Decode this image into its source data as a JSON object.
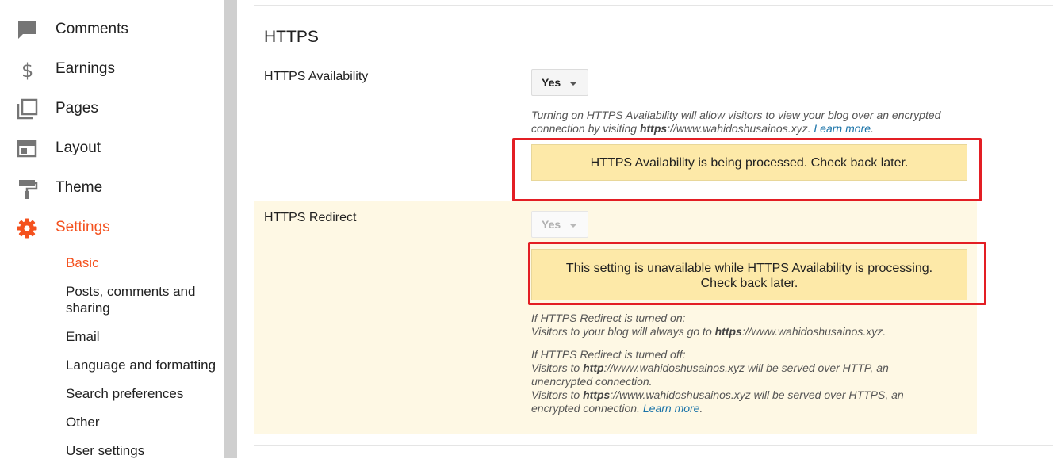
{
  "sidebar": {
    "items": [
      {
        "label": "Comments",
        "icon": "comment-icon"
      },
      {
        "label": "Earnings",
        "icon": "dollar-icon"
      },
      {
        "label": "Pages",
        "icon": "pages-icon"
      },
      {
        "label": "Layout",
        "icon": "layout-icon"
      },
      {
        "label": "Theme",
        "icon": "paint-roller-icon"
      },
      {
        "label": "Settings",
        "icon": "gear-icon",
        "active": true
      }
    ],
    "sub_items": [
      {
        "label": "Basic",
        "active": true
      },
      {
        "label": "Posts, comments and sharing"
      },
      {
        "label": "Email"
      },
      {
        "label": "Language and formatting"
      },
      {
        "label": "Search preferences"
      },
      {
        "label": "Other"
      },
      {
        "label": "User settings"
      }
    ],
    "accent_color": "#f4511e"
  },
  "main": {
    "section_title": "HTTPS",
    "availability": {
      "label": "HTTPS Availability",
      "value": "Yes",
      "help_prefix": "Turning on HTTPS Availability will allow visitors to view your blog over an encrypted connection by visiting ",
      "help_bold": "https",
      "help_suffix": "://www.wahidoshusainos.xyz. ",
      "help_link": "Learn more",
      "help_end": ".",
      "notice": "HTTPS Availability is being processed. Check back later."
    },
    "redirect": {
      "label": "HTTPS Redirect",
      "value": "Yes",
      "notice_line1": "This setting is unavailable while HTTPS Availability is processing.",
      "notice_line2": "Check back later.",
      "on_title": "If HTTPS Redirect is turned on:",
      "on_prefix": "Visitors to your blog will always go to ",
      "on_bold": "https",
      "on_suffix": "://www.wahidoshusainos.xyz.",
      "off_title": "If HTTPS Redirect is turned off:",
      "off1_prefix": "Visitors to ",
      "off1_bold": "http",
      "off1_suffix": "://www.wahidoshusainos.xyz will be served over HTTP, an unencrypted connection.",
      "off2_prefix": "Visitors to ",
      "off2_bold": "https",
      "off2_suffix": "://www.wahidoshusainos.xyz will be served over HTTPS, an encrypted connection. ",
      "off2_link": "Learn more",
      "off2_end": "."
    },
    "highlight_color": "#e31e24",
    "notice_color": "#fde9a8"
  }
}
